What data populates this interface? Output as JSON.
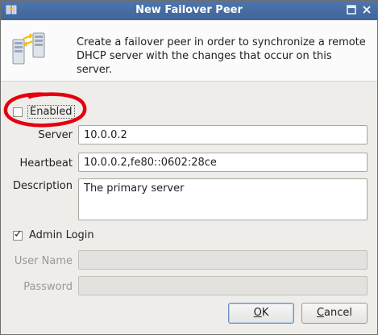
{
  "window": {
    "title": "New Failover Peer",
    "title_buttons": [
      "restore-icon",
      "close-icon"
    ]
  },
  "banner": {
    "icon": "server-sync-icon",
    "text": "Create a failover peer in order to synchronize a remote DHCP server with the changes that occur on this server."
  },
  "enabled": {
    "label": "Enabled",
    "checked": false
  },
  "form": {
    "server_label": "Server",
    "server_value": "10.0.0.2",
    "heartbeat_label": "Heartbeat",
    "heartbeat_value": "10.0.0.2,fe80::0602:28ce",
    "description_label": "Description",
    "description_value": "The primary server"
  },
  "admin": {
    "label": "Admin Login",
    "checked": true,
    "username_label": "User Name",
    "username_value": "",
    "password_label": "Password",
    "password_value": ""
  },
  "buttons": {
    "ok_prefix": "",
    "ok_mnemonic": "O",
    "ok_suffix": "K",
    "cancel_prefix": "",
    "cancel_mnemonic": "C",
    "cancel_suffix": "ancel"
  },
  "annotation_color": "#e3000f"
}
